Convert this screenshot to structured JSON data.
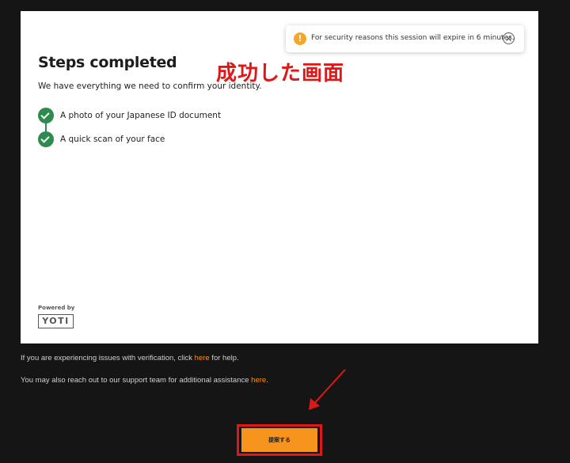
{
  "toast": {
    "icon": "warning-icon",
    "text": "For security reasons this session will expire in 6 minutes."
  },
  "steps": {
    "title": "Steps completed",
    "subtitle": "We have everything we need to confirm your identity.",
    "items": [
      {
        "label": "A photo of your Japanese ID document",
        "icon": "check-circle-icon",
        "status": "complete"
      },
      {
        "label": "A quick scan of your face",
        "icon": "check-circle-icon",
        "status": "complete"
      }
    ]
  },
  "annotation": {
    "text": "成功した画面",
    "color": "#e01717"
  },
  "branding": {
    "powered_by": "Powered by",
    "logo": "YOTI"
  },
  "help": {
    "line1_prefix": "If you are experiencing issues with verification, click ",
    "line1_link": "here",
    "line1_suffix": " for help.",
    "line2_prefix": "You may also reach out to our support team for additional assistance ",
    "line2_link": "here",
    "line2_suffix": "."
  },
  "submit": {
    "label": "提案する"
  },
  "colors": {
    "accent": "#f7941d",
    "success": "#2e8a4e",
    "annotation_red": "#e01717",
    "background": "#151515"
  }
}
